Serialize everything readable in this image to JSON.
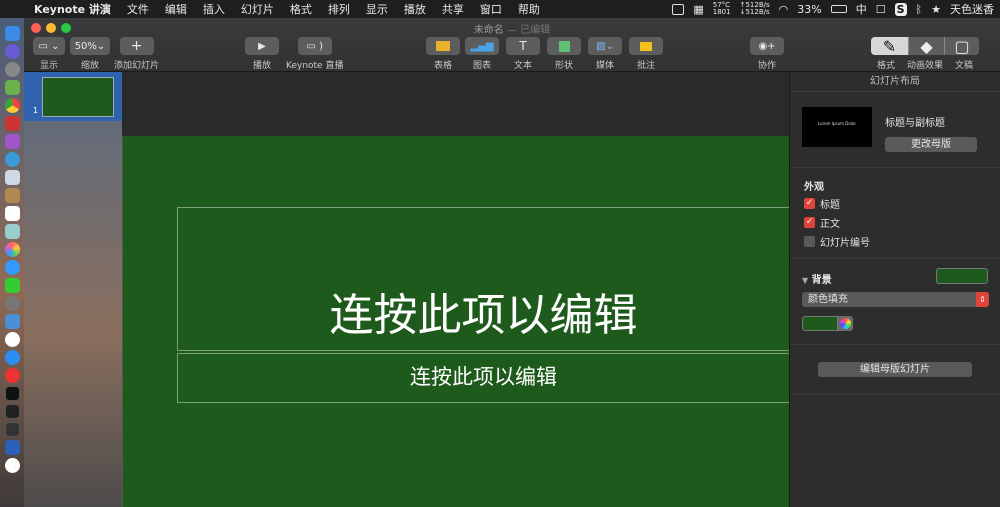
{
  "menubar": {
    "app_name": "Keynote 讲演",
    "items": [
      "文件",
      "编辑",
      "插入",
      "幻灯片",
      "格式",
      "排列",
      "显示",
      "播放",
      "共享",
      "窗口",
      "帮助"
    ],
    "temp": "57°C",
    "fan": "1801",
    "net_up": "↑512B/s",
    "net_down": "↓512B/s",
    "battery": "33%",
    "input_method": "中",
    "user": "天色迷香"
  },
  "window": {
    "title": "未命名",
    "edited": "— 已编辑"
  },
  "toolbar": {
    "view_label": "显示",
    "zoom_value": "50%",
    "zoom_label": "缩放",
    "add_slide_label": "添加幻灯片",
    "play_label": "播放",
    "keynote_live_label": "Keynote 直播",
    "table_label": "表格",
    "chart_label": "图表",
    "text_label": "文本",
    "shape_label": "形状",
    "media_label": "媒体",
    "comment_label": "批注",
    "collaborate_label": "协作",
    "format_label": "格式",
    "animate_label": "动画效果",
    "document_label": "文稿"
  },
  "navigator": {
    "slide_number": "1"
  },
  "slide": {
    "title": "连按此项以编辑",
    "subtitle": "连按此项以编辑",
    "background_color": "#1e5a1c"
  },
  "inspector": {
    "header": "幻灯片布局",
    "master_name": "标题与副标题",
    "master_thumb_text": "Lorem Ipsum Dolor",
    "change_master": "更改母版",
    "appearance": "外观",
    "options": [
      {
        "label": "标题",
        "checked": true
      },
      {
        "label": "正文",
        "checked": true
      },
      {
        "label": "幻灯片编号",
        "checked": false
      }
    ],
    "background": "背景",
    "fill_type": "颜色填充",
    "edit_master": "编辑母版幻灯片",
    "accent_color": "#e0433a"
  }
}
